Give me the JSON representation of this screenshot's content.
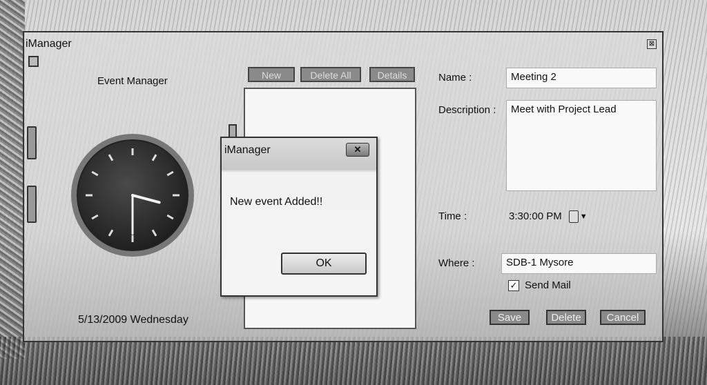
{
  "window": {
    "title": "iManager",
    "close_glyph": "⊠"
  },
  "left_panel": {
    "heading": "Event Manager",
    "date": "5/13/2009 Wednesday",
    "clock_time": {
      "hour": 3,
      "minute": 30
    }
  },
  "toolbar": {
    "new_label": "New",
    "delete_all_label": "Delete All",
    "details_label": "Details"
  },
  "form": {
    "name_label": "Name :",
    "name_value": "Meeting 2",
    "description_label": "Description :",
    "description_value": "Meet with Project Lead",
    "time_label": "Time :",
    "time_value": "3:30:00 PM",
    "where_label": "Where :",
    "where_value": "SDB-1 Mysore",
    "send_mail_label": "Send Mail",
    "send_mail_checked": true
  },
  "actions": {
    "save_label": "Save",
    "delete_label": "Delete",
    "cancel_label": "Cancel"
  },
  "dialog": {
    "title": "iManager",
    "message": "New event Added!!",
    "ok_label": "OK",
    "close_glyph": "✕"
  }
}
